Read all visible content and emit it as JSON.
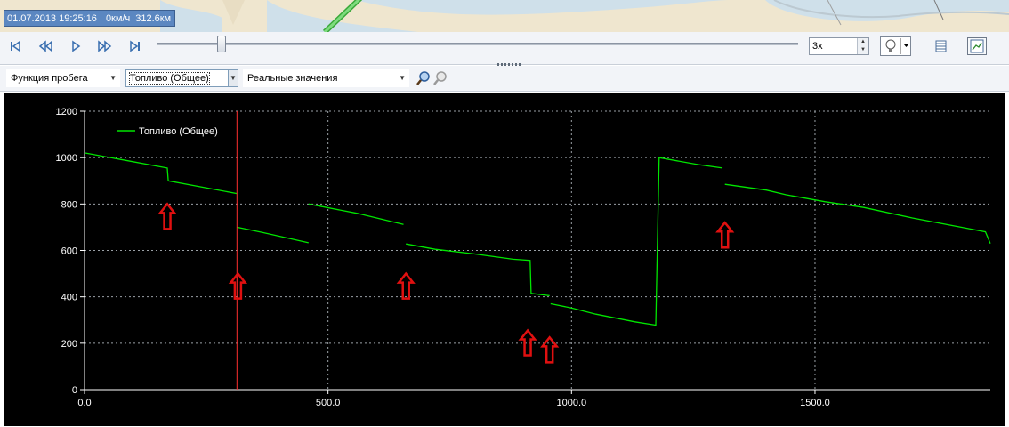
{
  "map": {
    "status_datetime": "01.07.2013 19:25:16",
    "status_speed": "0км/ч",
    "status_distance": "312.6км"
  },
  "player": {
    "buttons": [
      "to-start-icon",
      "rewind-icon",
      "play-icon",
      "fast-forward-icon",
      "to-end-icon"
    ],
    "slider_position": 0.1,
    "speed": "3x"
  },
  "filters": {
    "function": "Функция пробега",
    "parameter": "Топливо (Общее)",
    "mode": "Реальные значения"
  },
  "colors": {
    "series": "#00e600",
    "cursor": "#ff3030",
    "arrow": "#e01010",
    "map_status_bg": "#5b87c1"
  },
  "chart_data": {
    "type": "line",
    "x_ticks": [
      "0.0",
      "500.0",
      "1000.0",
      "1500.0"
    ],
    "y_ticks": [
      "0",
      "200",
      "400",
      "600",
      "800",
      "1000",
      "1200"
    ],
    "xlim": [
      0,
      1860
    ],
    "ylim": [
      0,
      1200
    ],
    "grid": true,
    "legend_position": "top-left",
    "cursor_x": 313,
    "series": [
      {
        "name": "Топливо (Общее)",
        "segments": [
          [
            [
              0,
              1020
            ],
            [
              80,
              990
            ],
            [
              170,
              955
            ],
            [
              172,
              900
            ],
            [
              313,
              845
            ]
          ],
          [
            [
              313,
              700
            ],
            [
              365,
              678
            ],
            [
              460,
              633
            ]
          ],
          [
            [
              460,
              800
            ],
            [
              560,
              760
            ],
            [
              655,
              712
            ]
          ],
          [
            [
              660,
              628
            ],
            [
              720,
              605
            ],
            [
              800,
              585
            ],
            [
              880,
              562
            ],
            [
              915,
              557
            ],
            [
              917,
              415
            ],
            [
              955,
              405
            ]
          ],
          [
            [
              957,
              370
            ],
            [
              1000,
              352
            ],
            [
              1050,
              325
            ],
            [
              1130,
              292
            ],
            [
              1173,
              278
            ],
            [
              1180,
              1000
            ],
            [
              1260,
              970
            ],
            [
              1310,
              955
            ]
          ],
          [
            [
              1315,
              885
            ],
            [
              1400,
              860
            ],
            [
              1440,
              840
            ],
            [
              1520,
              810
            ],
            [
              1600,
              785
            ],
            [
              1700,
              740
            ],
            [
              1800,
              700
            ],
            [
              1850,
              680
            ],
            [
              1860,
              630
            ]
          ]
        ]
      }
    ],
    "annotations": [
      {
        "type": "up-arrow",
        "x": 170,
        "y": 800
      },
      {
        "type": "up-arrow",
        "x": 315,
        "y": 500
      },
      {
        "type": "up-arrow",
        "x": 660,
        "y": 500
      },
      {
        "type": "up-arrow",
        "x": 910,
        "y": 255
      },
      {
        "type": "up-arrow",
        "x": 955,
        "y": 225
      },
      {
        "type": "up-arrow",
        "x": 1315,
        "y": 720
      }
    ]
  }
}
